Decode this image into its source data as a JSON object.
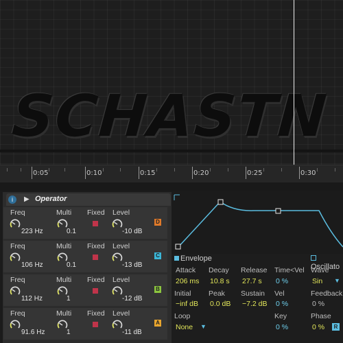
{
  "logo_text": "SCHASTN",
  "ruler": {
    "ticks": [
      "0:05",
      "0:10",
      "0:15",
      "0:20",
      "0:25",
      "0:30"
    ]
  },
  "device": {
    "info_label": "i",
    "title": "Operator",
    "oscillators": [
      {
        "freq_label": "Freq",
        "freq": "223 Hz",
        "multi_label": "Multi",
        "multi": "0.1",
        "fixed_label": "Fixed",
        "level_label": "Level",
        "level": "-10 dB",
        "tag": "D",
        "tag_color": "#e07a2a"
      },
      {
        "freq_label": "Freq",
        "freq": "106 Hz",
        "multi_label": "Multi",
        "multi": "0.1",
        "fixed_label": "Fixed",
        "level_label": "Level",
        "level": "-13 dB",
        "tag": "C",
        "tag_color": "#3bb7d8"
      },
      {
        "freq_label": "Freq",
        "freq": "112 Hz",
        "multi_label": "Multi",
        "multi": "1",
        "fixed_label": "Fixed",
        "level_label": "Level",
        "level": "-12 dB",
        "tag": "B",
        "tag_color": "#8cc63f"
      },
      {
        "freq_label": "Freq",
        "freq": "91.6 Hz",
        "multi_label": "Multi",
        "multi": "1",
        "fixed_label": "Fixed",
        "level_label": "Level",
        "level": "-11 dB",
        "tag": "A",
        "tag_color": "#e8a52e"
      }
    ]
  },
  "envelope": {
    "tab_envelope": "Envelope",
    "tab_oscillator": "Oscillato",
    "attack_label": "Attack",
    "attack": "206 ms",
    "decay_label": "Decay",
    "decay": "10.8 s",
    "release_label": "Release",
    "release": "27.7 s",
    "time_vel_label": "Time<Vel",
    "time_vel": "0 %",
    "initial_label": "Initial",
    "initial": "−inf dB",
    "peak_label": "Peak",
    "peak": "0.0 dB",
    "sustain_label": "Sustain",
    "sustain": "−7.2 dB",
    "vel_label": "Vel",
    "vel": "0 %",
    "loop_label": "Loop",
    "loop": "None",
    "key_label": "Key",
    "key": "0 %",
    "wave_label": "Wave",
    "wave": "Sin",
    "feedback_label": "Feedback",
    "feedback": "0 %",
    "phase_label": "Phase",
    "phase": "0 %",
    "phase_btn": "R"
  },
  "colors": {
    "accent": "#5bbde0",
    "value_yellow": "#e2e65a",
    "fixed_red": "#c0344a"
  }
}
